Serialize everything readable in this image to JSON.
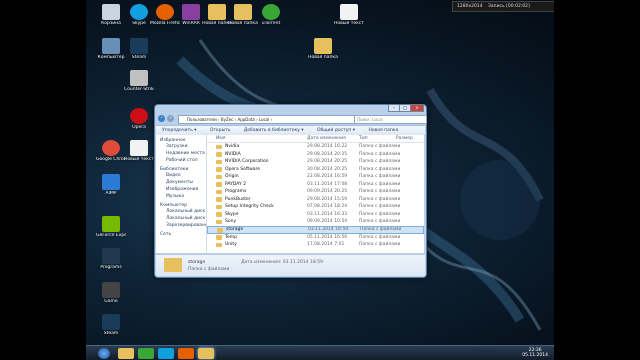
{
  "recorder": {
    "label": "Запись [00:02:02]",
    "size": "1280x2014"
  },
  "desktop_icons": [
    {
      "label": "Корзина",
      "color": "#c9d4de"
    },
    {
      "label": "Skype",
      "color": "#10a0e0"
    },
    {
      "label": "Mozilla Firefox",
      "color": "#e66000"
    },
    {
      "label": "WinRAR",
      "color": "#8a3fa0"
    },
    {
      "label": "Новая папка",
      "color": "#e6c05c"
    },
    {
      "label": "Новая папка",
      "color": "#e6c05c"
    },
    {
      "label": "uTorrent",
      "color": "#3aa635"
    },
    {
      "label": "Новый текстовый",
      "color": "#f2f2f2"
    },
    {
      "label": "Компьютер",
      "color": "#6a8fb6"
    },
    {
      "label": "Counter-Strike",
      "color": "#c0c0c0"
    },
    {
      "label": "Новая папка",
      "color": "#e6c05c"
    },
    {
      "label": "Steam",
      "color": "#183c5a"
    },
    {
      "label": "Google Chrome",
      "color": "#dd4b39"
    },
    {
      "label": "Opera",
      "color": "#cc0f16"
    },
    {
      "label": "AIMP",
      "color": "#2b7bd6"
    },
    {
      "label": "GeForce Experience",
      "color": "#76b900"
    },
    {
      "label": "Programs",
      "color": "#22384f"
    },
    {
      "label": "Game",
      "color": "#444"
    },
    {
      "label": "Steam",
      "color": "#183c5a"
    },
    {
      "label": "Новый текстовый документ",
      "color": "#f2f2f2"
    }
  ],
  "window": {
    "path": "Пользователи › ByZec › AppData › Local ›",
    "search_placeholder": "Поиск: Local",
    "toolbar": [
      "Упорядочить ▾",
      "Открыть",
      "Добавить в библиотеку ▾",
      "Общий доступ ▾",
      "Новая папка"
    ],
    "nav": {
      "favorites": "Избранное",
      "favorites_items": [
        "Загрузки",
        "Недавние места",
        "Рабочий стол"
      ],
      "libraries": "Библиотеки",
      "libraries_items": [
        "Видео",
        "Документы",
        "Изображения",
        "Музыка"
      ],
      "computer": "Компьютер",
      "computer_items": [
        "Локальный диск",
        "Локальный диск",
        "Зарезервировано"
      ],
      "network": "Сеть"
    },
    "columns": {
      "name": "Имя",
      "date": "Дата изменения",
      "type": "Тип",
      "size": "Размер"
    },
    "files": [
      {
        "name": "Nvidia",
        "date": "29.08.2014 16:22",
        "type": "Папка с файлами"
      },
      {
        "name": "NVIDIA",
        "date": "29.08.2014 20:25",
        "type": "Папка с файлами"
      },
      {
        "name": "NVIDIA Corporation",
        "date": "29.08.2014 20:25",
        "type": "Папка с файлами"
      },
      {
        "name": "Opera Software",
        "date": "30.08.2014 20:25",
        "type": "Папка с файлами"
      },
      {
        "name": "Origin",
        "date": "22.08.2014 16:59",
        "type": "Папка с файлами"
      },
      {
        "name": "PAYDAY 2",
        "date": "03.11.2014 17:08",
        "type": "Папка с файлами"
      },
      {
        "name": "Programs",
        "date": "09.09.2014 20:25",
        "type": "Папка с файлами"
      },
      {
        "name": "PunkBuster",
        "date": "29.08.2014 15:19",
        "type": "Папка с файлами"
      },
      {
        "name": "Setup Integrity Check",
        "date": "07.08.2014 18:24",
        "type": "Папка с файлами"
      },
      {
        "name": "Skype",
        "date": "03.11.2014 16:33",
        "type": "Папка с файлами"
      },
      {
        "name": "Sony",
        "date": "09.09.2014 10:54",
        "type": "Папка с файлами"
      },
      {
        "name": "storage",
        "date": "03.11.2014 16:59",
        "type": "Папка с файлами",
        "selected": true
      },
      {
        "name": "Temp",
        "date": "05.11.2014 16:56",
        "type": "Папка с файлами"
      },
      {
        "name": "Unity",
        "date": "17.08.2014 7:01",
        "type": "Папка с файлами"
      }
    ],
    "details": {
      "name": "storage",
      "date_label": "Дата изменения: 03.11.2014 18:59",
      "type": "Папка с файлами"
    }
  },
  "taskbar": {
    "time": "22:36",
    "date": "05.11.2014"
  }
}
